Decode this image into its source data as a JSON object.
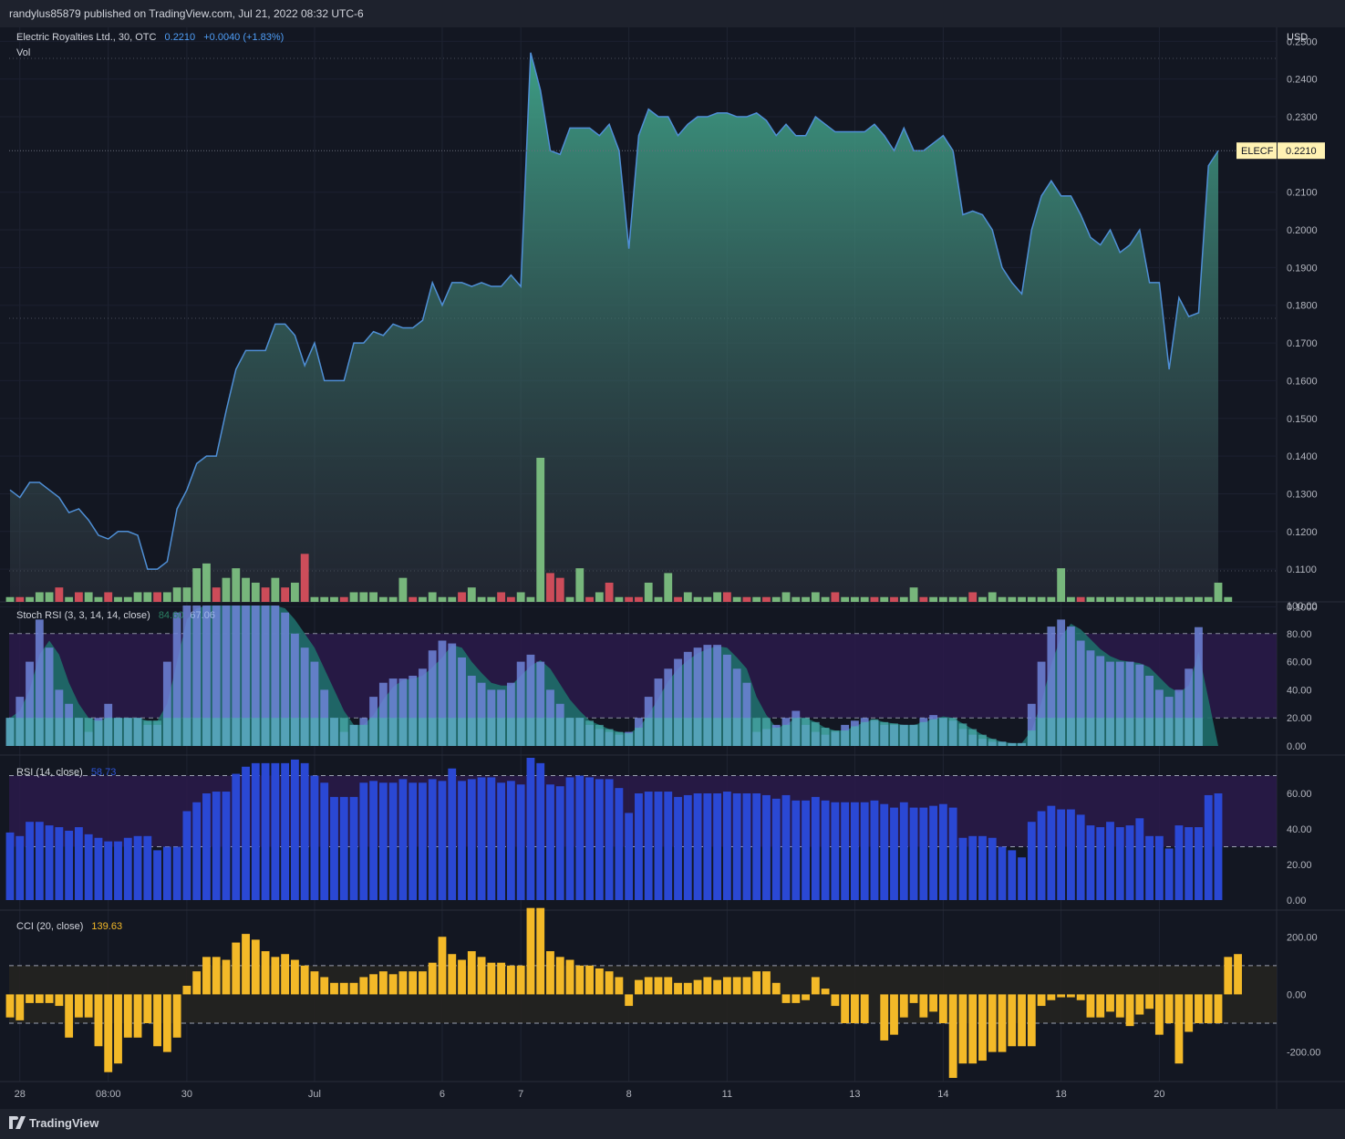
{
  "header": {
    "published": "randylus85879 published on TradingView.com, Jul 21, 2022 08:32 UTC-6"
  },
  "footer": {
    "brand": "TradingView"
  },
  "symbol": {
    "name": "Electric Royalties Ltd., 30, OTC",
    "price": "0.2210",
    "change": "+0.0040 (+1.83%)",
    "vol_label": "Vol",
    "ticker_tag": "ELECF",
    "tag_price": "0.2210",
    "currency": "USD"
  },
  "colors": {
    "bg": "#131722",
    "up": "#81c784",
    "down": "#e0515e",
    "line": "#4f8fd6",
    "stoch_k": "#6f84d8",
    "stoch_d": "#4fb0b0",
    "rsi": "#2a48d4",
    "cci": "#f3b928"
  },
  "indicators": {
    "stoch_label": "Stoch RSI (3, 3, 14, 14, close)",
    "stoch_k_value": "84.60",
    "stoch_d_value": "67.06",
    "rsi_label": "RSI (14, close)",
    "rsi_value": "58.73",
    "cci_label": "CCI (20, close)",
    "cci_value": "139.63"
  },
  "axes": {
    "x_ticks": [
      "28",
      "08:00",
      "30",
      "Jul",
      "6",
      "7",
      "8",
      "11",
      "13",
      "14",
      "18",
      "20"
    ],
    "price_ticks": [
      "0.2500",
      "0.2400",
      "0.2300",
      "0.2100",
      "0.2000",
      "0.1900",
      "0.1800",
      "0.1700",
      "0.1600",
      "0.1500",
      "0.1400",
      "0.1300",
      "0.1200",
      "0.1100",
      "0.1000"
    ],
    "stoch_ticks": [
      "100.00",
      "80.00",
      "60.00",
      "40.00",
      "20.00",
      "0.00"
    ],
    "rsi_ticks": [
      "60.00",
      "40.00",
      "20.00",
      "0.00"
    ],
    "cci_ticks": [
      "200.00",
      "0.00",
      "-200.00"
    ]
  },
  "chart_data": [
    {
      "type": "area",
      "title": "Electric Royalties Ltd., 30, OTC",
      "ylabel": "USD",
      "ylim": [
        0.096,
        0.2525
      ],
      "values": [
        0.131,
        0.129,
        0.133,
        0.133,
        0.131,
        0.129,
        0.125,
        0.126,
        0.123,
        0.119,
        0.118,
        0.12,
        0.12,
        0.119,
        0.11,
        0.11,
        0.112,
        0.126,
        0.131,
        0.138,
        0.14,
        0.14,
        0.152,
        0.163,
        0.168,
        0.168,
        0.168,
        0.175,
        0.175,
        0.172,
        0.164,
        0.17,
        0.16,
        0.16,
        0.16,
        0.17,
        0.17,
        0.173,
        0.172,
        0.175,
        0.174,
        0.174,
        0.176,
        0.186,
        0.18,
        0.186,
        0.186,
        0.185,
        0.186,
        0.185,
        0.185,
        0.188,
        0.185,
        0.247,
        0.237,
        0.221,
        0.22,
        0.227,
        0.227,
        0.227,
        0.225,
        0.228,
        0.221,
        0.195,
        0.225,
        0.232,
        0.23,
        0.23,
        0.225,
        0.228,
        0.23,
        0.23,
        0.231,
        0.231,
        0.23,
        0.23,
        0.231,
        0.229,
        0.225,
        0.228,
        0.225,
        0.225,
        0.23,
        0.228,
        0.226,
        0.226,
        0.226,
        0.226,
        0.228,
        0.225,
        0.221,
        0.227,
        0.221,
        0.221,
        0.223,
        0.225,
        0.221,
        0.204,
        0.205,
        0.204,
        0.2,
        0.19,
        0.186,
        0.183,
        0.2,
        0.209,
        0.213,
        0.209,
        0.209,
        0.204,
        0.198,
        0.196,
        0.2,
        0.194,
        0.196,
        0.2,
        0.186,
        0.186,
        0.163,
        0.182,
        0.177,
        0.178,
        0.217,
        0.221
      ]
    },
    {
      "type": "bar",
      "title": "Vol",
      "values": [
        1,
        1,
        1,
        2,
        2,
        3,
        1,
        2,
        2,
        1,
        2,
        1,
        1,
        2,
        2,
        2,
        2,
        3,
        3,
        7,
        8,
        3,
        5,
        7,
        5,
        4,
        3,
        5,
        3,
        4,
        10,
        1,
        1,
        1,
        1,
        2,
        2,
        2,
        1,
        1,
        5,
        1,
        1,
        2,
        1,
        1,
        2,
        3,
        1,
        1,
        2,
        1,
        2,
        1,
        30,
        6,
        5,
        1,
        7,
        1,
        2,
        4,
        1,
        1,
        1,
        4,
        1,
        6,
        1,
        2,
        1,
        1,
        2,
        2,
        1,
        1,
        1,
        1,
        1,
        2,
        1,
        1,
        2,
        1,
        2,
        1,
        1,
        1,
        1,
        1,
        1,
        1,
        3,
        1,
        1,
        1,
        1,
        1,
        2,
        1,
        2,
        1,
        1,
        1,
        1,
        1,
        1,
        7,
        1,
        1,
        1,
        1,
        1,
        1,
        1,
        1,
        1,
        1,
        1,
        1,
        1,
        1,
        1,
        4,
        1
      ],
      "directions": [
        "u",
        "d",
        "u",
        "u",
        "u",
        "d",
        "u",
        "d",
        "u",
        "u",
        "d",
        "u",
        "u",
        "u",
        "u",
        "d",
        "u",
        "u",
        "u",
        "u",
        "u",
        "d",
        "u",
        "u",
        "u",
        "u",
        "d",
        "u",
        "d",
        "u",
        "d",
        "u",
        "u",
        "u",
        "d",
        "u",
        "u",
        "u",
        "u",
        "u",
        "u",
        "d",
        "u",
        "u",
        "u",
        "u",
        "d",
        "u",
        "u",
        "u",
        "d",
        "d",
        "u",
        "u",
        "u",
        "d",
        "d",
        "u",
        "u",
        "d",
        "u",
        "d",
        "u",
        "d",
        "d",
        "u",
        "u",
        "u",
        "d",
        "u",
        "u",
        "u",
        "u",
        "d",
        "u",
        "d",
        "u",
        "d",
        "u",
        "u",
        "u",
        "u",
        "u",
        "u",
        "d",
        "u",
        "u",
        "u",
        "d",
        "u",
        "d",
        "u",
        "u",
        "d",
        "u",
        "u",
        "u",
        "u",
        "d",
        "u",
        "u",
        "u",
        "u",
        "u",
        "u",
        "u",
        "u",
        "u",
        "u",
        "d",
        "u",
        "u",
        "u",
        "u",
        "u",
        "u",
        "u",
        "u",
        "u",
        "u",
        "u",
        "u",
        "u",
        "u",
        "u"
      ]
    },
    {
      "type": "bar",
      "title": "Stoch RSI (3, 3, 14, 14, close)",
      "ylim": [
        0,
        100
      ],
      "series": [
        {
          "name": "K",
          "values": [
            20,
            35,
            60,
            90,
            70,
            40,
            30,
            20,
            10,
            20,
            30,
            20,
            20,
            20,
            15,
            15,
            60,
            95,
            100,
            100,
            100,
            100,
            100,
            100,
            100,
            100,
            100,
            100,
            95,
            80,
            70,
            60,
            40,
            20,
            10,
            15,
            20,
            35,
            45,
            48,
            48,
            50,
            55,
            68,
            75,
            73,
            63,
            50,
            45,
            40,
            40,
            45,
            60,
            65,
            60,
            40,
            30,
            20,
            20,
            15,
            12,
            10,
            8,
            10,
            20,
            35,
            48,
            55,
            62,
            67,
            70,
            72,
            72,
            65,
            55,
            45,
            10,
            12,
            15,
            20,
            25,
            15,
            10,
            8,
            10,
            15,
            18,
            20,
            18,
            15,
            15,
            15,
            15,
            20,
            22,
            20,
            18,
            12,
            8,
            5,
            3,
            3,
            2,
            2,
            30,
            60,
            85,
            90,
            85,
            75,
            68,
            64,
            60,
            60,
            60,
            58,
            50,
            40,
            35,
            40,
            55,
            84.6
          ]
        },
        {
          "name": "D",
          "values": [
            20,
            25,
            40,
            65,
            75,
            65,
            45,
            30,
            20,
            18,
            20,
            20,
            20,
            20,
            18,
            18,
            30,
            60,
            90,
            98,
            100,
            100,
            100,
            100,
            100,
            100,
            100,
            100,
            98,
            90,
            80,
            70,
            55,
            40,
            25,
            15,
            15,
            22,
            33,
            42,
            47,
            48,
            50,
            56,
            63,
            72,
            70,
            60,
            52,
            45,
            43,
            43,
            50,
            57,
            61,
            55,
            44,
            33,
            25,
            18,
            15,
            12,
            10,
            9,
            13,
            22,
            34,
            46,
            55,
            61,
            66,
            69,
            71,
            70,
            63,
            55,
            35,
            22,
            13,
            15,
            20,
            20,
            17,
            13,
            11,
            11,
            14,
            17,
            19,
            17,
            16,
            15,
            15,
            17,
            19,
            21,
            20,
            16,
            12,
            8,
            5,
            3,
            2,
            2,
            11,
            31,
            58,
            78,
            87,
            83,
            76,
            69,
            64,
            61,
            60,
            59,
            56,
            49,
            42,
            38,
            43,
            67.06
          ]
        }
      ]
    },
    {
      "type": "bar",
      "title": "RSI (14, close)",
      "ylim": [
        0,
        80
      ],
      "values": [
        38,
        36,
        44,
        44,
        42,
        41,
        39,
        41,
        37,
        35,
        33,
        33,
        35,
        36,
        36,
        28,
        30,
        30,
        50,
        55,
        60,
        61,
        61,
        71,
        75,
        77,
        77,
        77,
        77,
        79,
        77,
        70,
        66,
        58,
        58,
        58,
        66,
        67,
        66,
        66,
        68,
        66,
        66,
        68,
        67,
        74,
        67,
        68,
        69,
        69,
        66,
        67,
        65,
        80,
        77,
        65,
        64,
        69,
        70,
        69,
        68,
        68,
        63,
        49,
        60,
        61,
        61,
        61,
        58,
        59,
        60,
        60,
        60,
        61,
        60,
        60,
        60,
        59,
        57,
        59,
        56,
        56,
        58,
        56,
        55,
        55,
        55,
        55,
        56,
        54,
        52,
        55,
        52,
        52,
        53,
        54,
        52,
        35,
        36,
        36,
        35,
        30,
        28,
        24,
        44,
        50,
        53,
        51,
        51,
        48,
        42,
        41,
        44,
        41,
        42,
        46,
        36,
        36,
        29,
        42,
        41,
        41,
        59,
        60
      ]
    },
    {
      "type": "bar",
      "title": "CCI (20, close)",
      "ylim": [
        -290,
        280
      ],
      "values": [
        -80,
        -90,
        -30,
        -30,
        -30,
        -40,
        -150,
        -80,
        -80,
        -180,
        -270,
        -240,
        -150,
        -150,
        -100,
        -180,
        -200,
        -150,
        30,
        80,
        130,
        130,
        120,
        180,
        210,
        190,
        150,
        130,
        140,
        120,
        100,
        80,
        60,
        40,
        40,
        40,
        60,
        70,
        80,
        70,
        80,
        80,
        80,
        110,
        200,
        140,
        120,
        150,
        130,
        110,
        110,
        100,
        100,
        300,
        300,
        150,
        130,
        120,
        100,
        100,
        90,
        80,
        60,
        -40,
        50,
        60,
        60,
        60,
        40,
        40,
        50,
        60,
        50,
        60,
        60,
        60,
        80,
        80,
        40,
        -30,
        -30,
        -20,
        60,
        20,
        -40,
        -100,
        -100,
        -100,
        0,
        -160,
        -140,
        -80,
        -30,
        -80,
        -60,
        -100,
        -290,
        -240,
        -240,
        -230,
        -200,
        -200,
        -180,
        -180,
        -180,
        -40,
        -20,
        -10,
        -10,
        -20,
        -80,
        -80,
        -60,
        -80,
        -110,
        -70,
        -50,
        -140,
        -100,
        -240,
        -130,
        -100,
        -100,
        -100,
        130,
        140
      ]
    }
  ]
}
